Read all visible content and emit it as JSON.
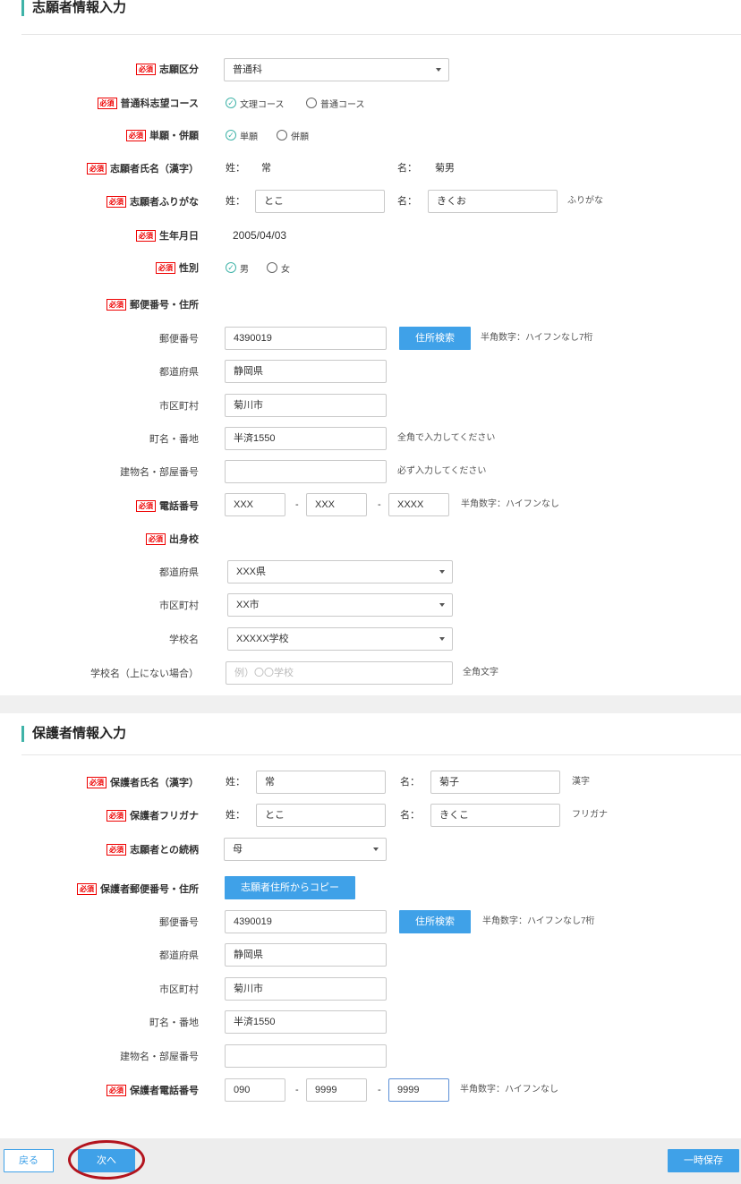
{
  "applicant": {
    "title": "志願者情報入力",
    "required_badge": "必須",
    "fields": {
      "category_label": "志願区分",
      "category_value": "普通科",
      "course_label": "普通科志望コース",
      "course_opt1": "文理コース",
      "course_opt2": "普通コース",
      "single_label": "単願・併願",
      "single_opt1": "単願",
      "single_opt2": "併願",
      "name_label": "志願者氏名（漢字）",
      "sei_prefix": "姓：",
      "mei_prefix": "名：",
      "sei": "常",
      "mei": "菊男",
      "furi_label": "志願者ふりがな",
      "furi_sei": "とこ",
      "furi_mei": "きくお",
      "furi_hint": "ふりがな",
      "birth_label": "生年月日",
      "birth_value": "2005/04/03",
      "gender_label": "性別",
      "gender_opt1": "男",
      "gender_opt2": "女",
      "address_label": "郵便番号・住所",
      "zip_label": "郵便番号",
      "zip_value": "4390019",
      "zip_search": "住所検索",
      "zip_hint": "半角数字：ハイフンなし7桁",
      "pref_label": "都道府県",
      "pref_value": "静岡県",
      "city_label": "市区町村",
      "city_value": "菊川市",
      "town_label": "町名・番地",
      "town_value": "半済1550",
      "town_hint": "全角で入力してください",
      "bldg_label": "建物名・部屋番号",
      "bldg_value": "",
      "bldg_hint": "必ず入力してください",
      "tel_label": "電話番号",
      "tel1": "XXX",
      "tel2": "XXX",
      "tel3": "XXXX",
      "tel_sep": "-",
      "tel_hint": "半角数字：ハイフンなし",
      "school_label": "出身校",
      "school_pref_label": "都道府県",
      "school_pref_value": "XXX県",
      "school_city_label": "市区町村",
      "school_city_value": "XX市",
      "school_name_label": "学校名",
      "school_name_value": "XXXXX学校",
      "school_other_label": "学校名（上にない場合）",
      "school_other_placeholder": "例）〇〇学校",
      "school_other_hint": "全角文字"
    }
  },
  "guardian": {
    "title": "保護者情報入力",
    "fields": {
      "name_label": "保護者氏名（漢字）",
      "sei": "常",
      "mei": "菊子",
      "name_hint": "漢字",
      "kana_label": "保護者フリガナ",
      "kana_sei": "とこ",
      "kana_mei": "きくこ",
      "kana_hint": "フリガナ",
      "relation_label": "志願者との続柄",
      "relation_value": "母",
      "address_label": "保護者郵便番号・住所",
      "copy_button": "志願者住所からコピー",
      "zip_label": "郵便番号",
      "zip_value": "4390019",
      "zip_search": "住所検索",
      "zip_hint": "半角数字：ハイフンなし7桁",
      "pref_label": "都道府県",
      "pref_value": "静岡県",
      "city_label": "市区町村",
      "city_value": "菊川市",
      "town_label": "町名・番地",
      "town_value": "半済1550",
      "bldg_label": "建物名・部屋番号",
      "bldg_value": "",
      "tel_label": "保護者電話番号",
      "tel1": "090",
      "tel2": "9999",
      "tel3": "9999",
      "tel_hint": "半角数字：ハイフンなし"
    }
  },
  "footer": {
    "back": "戻る",
    "next": "次へ",
    "save": "一時保存"
  },
  "colors": {
    "accent": "#3fb3a8",
    "button": "#3fa1e8",
    "required": "#ee0000",
    "highlight_circle": "#b3141e"
  }
}
